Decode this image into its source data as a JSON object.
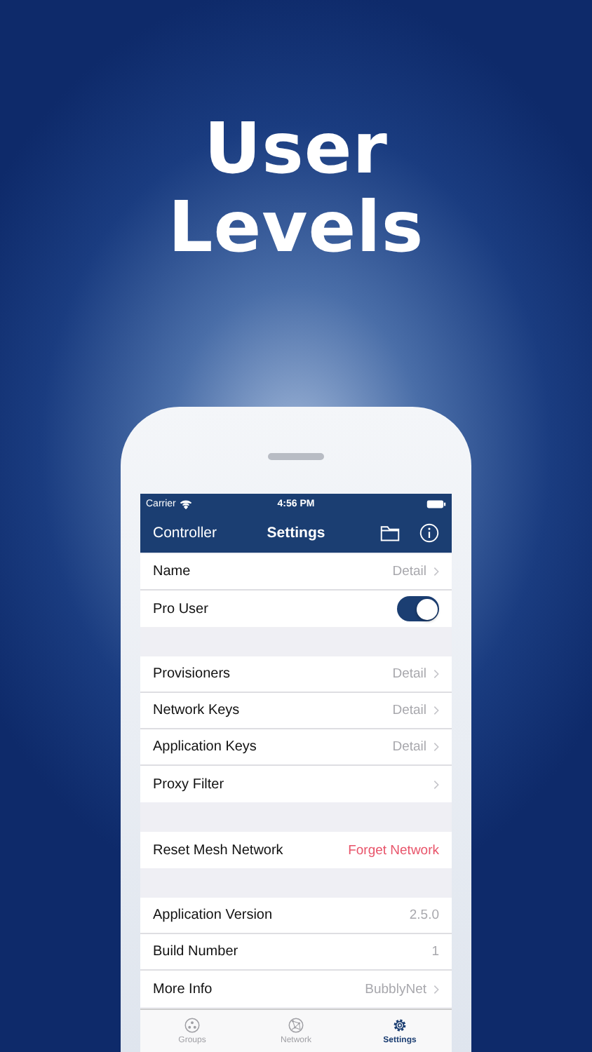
{
  "headline": [
    "User",
    "Levels"
  ],
  "status_bar": {
    "carrier": "Carrier",
    "time": "4:56 PM"
  },
  "nav_bar": {
    "left": "Controller",
    "title": "Settings"
  },
  "sections": [
    {
      "rows": [
        {
          "kind": "link",
          "label": "Name",
          "value": "Detail"
        },
        {
          "kind": "toggle",
          "label": "Pro User",
          "on": true
        }
      ]
    },
    {
      "rows": [
        {
          "kind": "link",
          "label": "Provisioners",
          "value": "Detail"
        },
        {
          "kind": "link",
          "label": "Network Keys",
          "value": "Detail"
        },
        {
          "kind": "link",
          "label": "Application Keys",
          "value": "Detail"
        },
        {
          "kind": "link",
          "label": "Proxy Filter"
        }
      ]
    },
    {
      "rows": [
        {
          "kind": "action",
          "label": "Reset Mesh Network",
          "value": "Forget Network"
        }
      ]
    },
    {
      "rows": [
        {
          "kind": "info",
          "label": "Application Version",
          "value": "2.5.0"
        },
        {
          "kind": "info",
          "label": "Build Number",
          "value": "1"
        },
        {
          "kind": "link",
          "label": "More Info",
          "value": "BubblyNet"
        }
      ]
    }
  ],
  "tab_bar": [
    {
      "label": "Groups",
      "kind": "groups",
      "selected": false
    },
    {
      "label": "Network",
      "kind": "network",
      "selected": false
    },
    {
      "label": "Settings",
      "kind": "settings",
      "selected": true
    }
  ]
}
